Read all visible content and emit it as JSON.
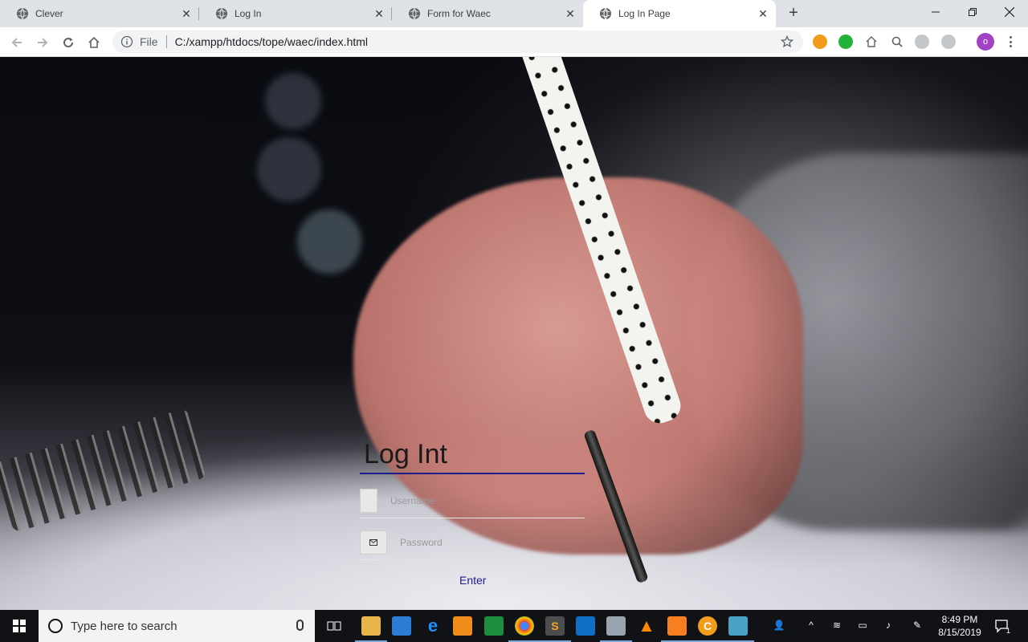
{
  "browser": {
    "tabs": [
      {
        "label": "Clever"
      },
      {
        "label": "Log In"
      },
      {
        "label": "Form for Waec"
      },
      {
        "label": "Log In Page"
      }
    ],
    "address": {
      "scheme_label": "File",
      "url": "C:/xampp/htdocs/tope/waec/index.html"
    },
    "profile_initial": "o"
  },
  "login": {
    "title": "Log Int",
    "username_placeholder": "Username",
    "password_placeholder": "Password",
    "enter_label": "Enter"
  },
  "taskbar": {
    "search_placeholder": "Type here to search",
    "time": "8:49 PM",
    "date": "8/15/2019",
    "notification_count": "1"
  },
  "colors": {
    "accent": "#1c1e8c",
    "tabstrip": "#dee1e6"
  }
}
